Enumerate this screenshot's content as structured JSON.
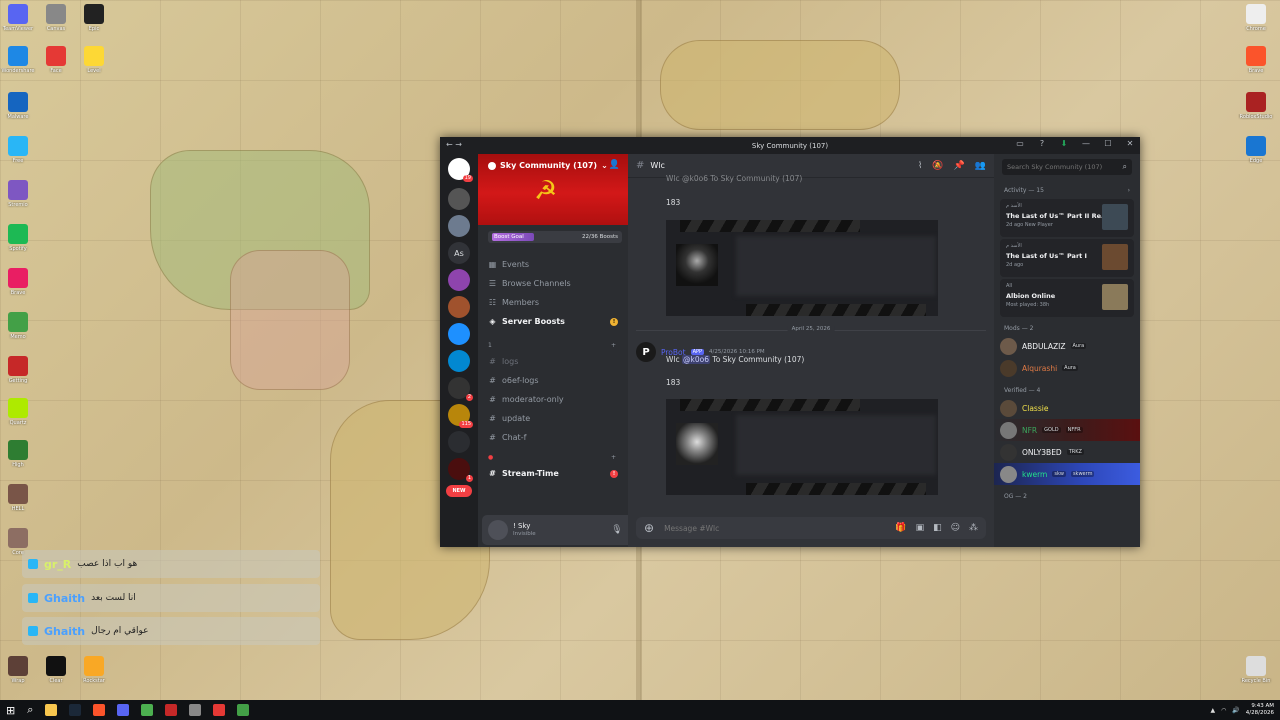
{
  "window": {
    "title": "Sky Community (107)",
    "nav": "← →"
  },
  "server": {
    "name": "Sky Community (107)",
    "boost_goal_label": "Boost Goal",
    "boost_progress": "22/36 Boosts",
    "boost_fraction": 0.61
  },
  "rail": {
    "home_badge": "19",
    "text_server": "As",
    "badge_2": "2",
    "badge_115": "115",
    "badge_1": "1",
    "new_label": "NEW"
  },
  "channels": {
    "top": [
      {
        "icon": "calendar-icon",
        "label": "Events"
      },
      {
        "icon": "browse-icon",
        "label": "Browse Channels"
      },
      {
        "icon": "members-icon",
        "label": "Members"
      },
      {
        "icon": "boost-icon",
        "label": "Server Boosts",
        "alert": "!"
      }
    ],
    "category_1": "1",
    "list_1": [
      "logs",
      "o6ef-logs",
      "moderator-only",
      "update",
      "Chat-f"
    ],
    "list_2": [
      {
        "label": "Stream-Time",
        "alert": "!"
      }
    ]
  },
  "user": {
    "name": "! Sky",
    "status": "Invisible"
  },
  "chat": {
    "channel": "Wlc",
    "first_msg_partial": "Wlc @k0o6 To Sky Community (107)",
    "first_num": "183",
    "date_divider": "April 25, 2026",
    "author": "ProBot",
    "app_tag": "APP",
    "time": "4/25/2026 10:16 PM",
    "msg_prefix": "Wlc",
    "mention": "@k0o6",
    "msg_suffix": "To Sky Community (107)",
    "second_num": "183",
    "composer_placeholder": "Message #Wlc"
  },
  "members": {
    "search_placeholder": "Search Sky Community (107)",
    "activity_header": "Activity — 15",
    "activities": [
      {
        "who": "الأسد م",
        "game": "The Last of Us™ Part II Re...",
        "sub": "2d ago  New Player"
      },
      {
        "who": "الأسد م",
        "game": "The Last of Us™ Part I",
        "sub": "2d ago"
      },
      {
        "who": "All",
        "game": "Albion Online",
        "sub": "Most played: 38h"
      }
    ],
    "mods_header": "Mods — 2",
    "mods": [
      {
        "name": "ABDULAZIZ",
        "tag": "Aura",
        "color": "#f2f3f5"
      },
      {
        "name": "Alqurashi",
        "tag": "Aura",
        "color": "#e07a45"
      }
    ],
    "verified_header": "Verified — 4",
    "verified": [
      {
        "name": "Classie",
        "tag": "",
        "color": "#f0e04a"
      },
      {
        "name": "NFR",
        "tag": "GOLD",
        "sub": "NFFR",
        "color": "#3ba55c"
      },
      {
        "name": "ONLY3BED",
        "tag": "TRKZ",
        "color": "#f2f3f5"
      },
      {
        "name": "kwerm",
        "tag": "skw",
        "sub": "skwerm",
        "color": "#23e08a"
      }
    ],
    "og_header": "OG — 2"
  },
  "overlay": [
    {
      "name": "gr_R",
      "msg": "هو اب اذا عصب",
      "name_color": "#d8f06a"
    },
    {
      "name": "Ghaith",
      "msg": "انا لست بعد",
      "name_color": "#4aa0ff"
    },
    {
      "name": "Ghaith",
      "msg": "عواقي ام رجال",
      "name_color": "#4aa0ff"
    }
  ],
  "taskbar": {
    "time": "9:43 AM",
    "date": "4/28/2026"
  },
  "colors": {
    "discord_bg": "#313338",
    "banner_red": "#d31818",
    "blurple": "#5865f2"
  }
}
